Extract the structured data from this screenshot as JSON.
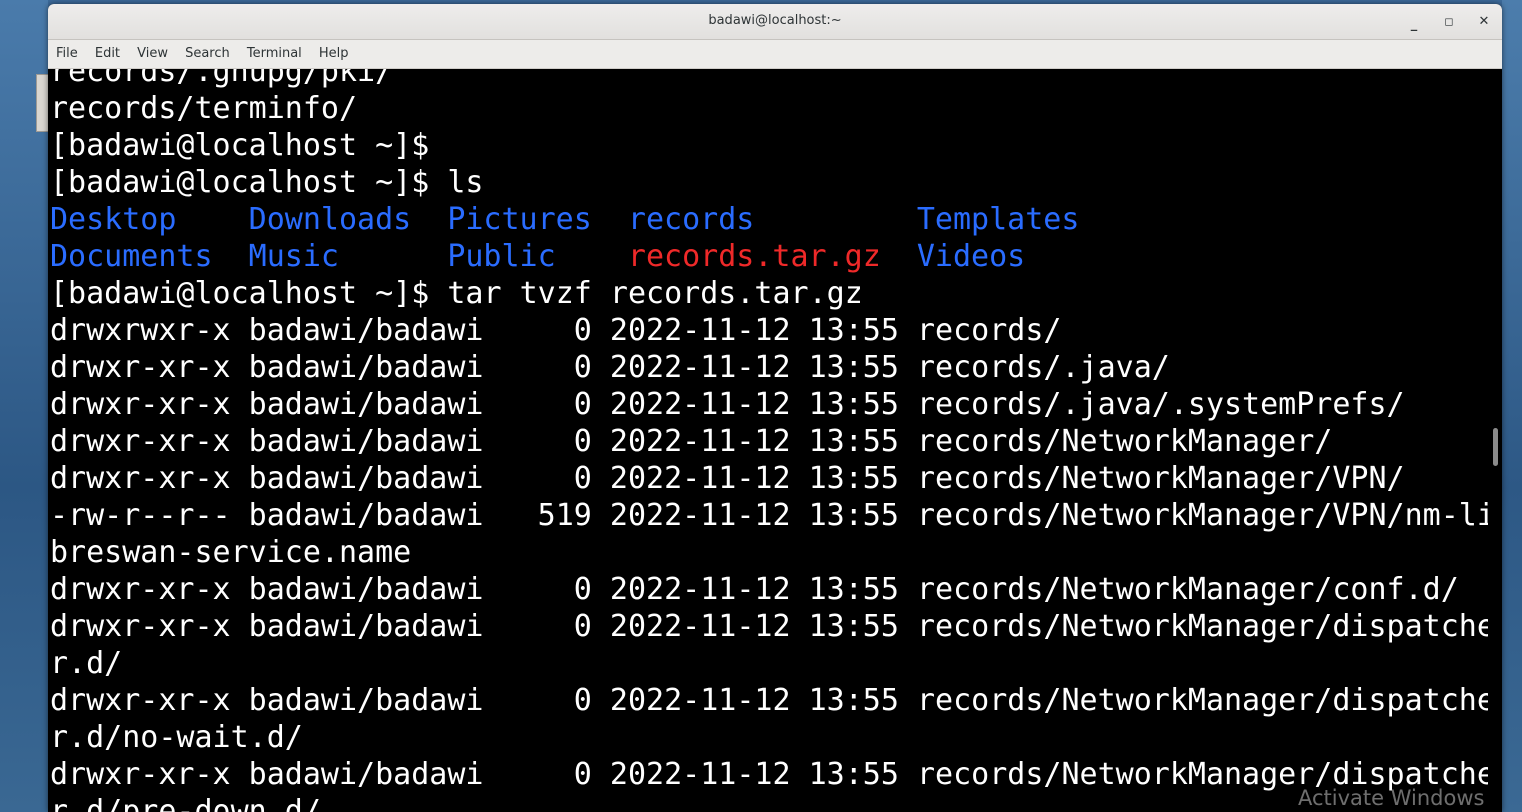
{
  "window": {
    "title": "badawi@localhost:~",
    "minimize": "_",
    "maximize": "◻",
    "close": "✕"
  },
  "menu": [
    "File",
    "Edit",
    "View",
    "Search",
    "Terminal",
    "Help"
  ],
  "terminal": {
    "lines": [
      "records/.gnupg/pki/",
      "records/terminfo/",
      "[badawi@localhost ~]$",
      "[badawi@localhost ~]$ ls"
    ],
    "ls_rows": [
      [
        {
          "text": "Desktop",
          "type": "dir"
        },
        {
          "text": "Downloads",
          "type": "dir"
        },
        {
          "text": "Pictures",
          "type": "dir"
        },
        {
          "text": "records",
          "type": "dir"
        },
        {
          "text": "Templates",
          "type": "dir"
        }
      ],
      [
        {
          "text": "Documents",
          "type": "dir"
        },
        {
          "text": "Music",
          "type": "dir"
        },
        {
          "text": "Public",
          "type": "dir"
        },
        {
          "text": "records.tar.gz",
          "type": "arch"
        },
        {
          "text": "Videos",
          "type": "dir"
        }
      ]
    ],
    "lines_after": [
      "[badawi@localhost ~]$ tar tvzf records.tar.gz",
      "drwxrwxr-x badawi/badawi     0 2022-11-12 13:55 records/",
      "drwxr-xr-x badawi/badawi     0 2022-11-12 13:55 records/.java/",
      "drwxr-xr-x badawi/badawi     0 2022-11-12 13:55 records/.java/.systemPrefs/",
      "drwxr-xr-x badawi/badawi     0 2022-11-12 13:55 records/NetworkManager/",
      "drwxr-xr-x badawi/badawi     0 2022-11-12 13:55 records/NetworkManager/VPN/",
      "-rw-r--r-- badawi/badawi   519 2022-11-12 13:55 records/NetworkManager/VPN/nm-li",
      "breswan-service.name",
      "drwxr-xr-x badawi/badawi     0 2022-11-12 13:55 records/NetworkManager/conf.d/",
      "drwxr-xr-x badawi/badawi     0 2022-11-12 13:55 records/NetworkManager/dispatche",
      "r.d/",
      "drwxr-xr-x badawi/badawi     0 2022-11-12 13:55 records/NetworkManager/dispatche",
      "r.d/no-wait.d/",
      "drwxr-xr-x badawi/badawi     0 2022-11-12 13:55 records/NetworkManager/dispatche",
      "r.d/pre-down.d/"
    ]
  },
  "watermark": "Activate Windows",
  "colors": {
    "directory": "#2a6cff",
    "archive": "#ef2929",
    "text": "#ffffff",
    "background": "#000000"
  }
}
